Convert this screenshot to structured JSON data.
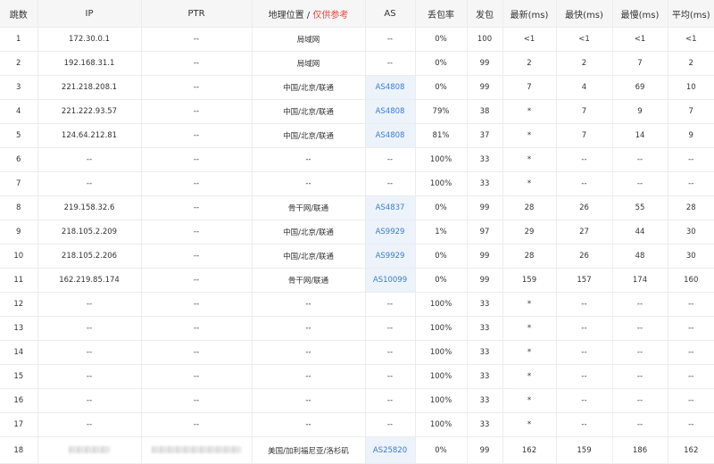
{
  "headers": {
    "hop": "跳数",
    "ip": "IP",
    "ptr": "PTR",
    "geo": "地理位置",
    "geo_sep": " / ",
    "geo_note": "仅供参考",
    "as": "AS",
    "loss": "丢包率",
    "sent": "发包",
    "last": "最新(ms)",
    "best": "最快(ms)",
    "worst": "最慢(ms)",
    "avg": "平均(ms)"
  },
  "colors": {
    "accent_link": "#3a7bd5",
    "note_red": "#e8463c",
    "as_cell_bg": "#edf3fb",
    "header_bg": "#f6f6f6"
  },
  "rows": [
    {
      "hop": "1",
      "ip": "172.30.0.1",
      "ptr": "--",
      "geo": "局域网",
      "as": "--",
      "loss": "0%",
      "sent": "100",
      "last": "<1",
      "best": "<1",
      "worst": "<1",
      "avg": "<1"
    },
    {
      "hop": "2",
      "ip": "192.168.31.1",
      "ptr": "--",
      "geo": "局域网",
      "as": "--",
      "loss": "0%",
      "sent": "99",
      "last": "2",
      "best": "2",
      "worst": "7",
      "avg": "2"
    },
    {
      "hop": "3",
      "ip": "221.218.208.1",
      "ptr": "--",
      "geo": "中国/北京/联通",
      "as": "AS4808",
      "loss": "0%",
      "sent": "99",
      "last": "7",
      "best": "4",
      "worst": "69",
      "avg": "10"
    },
    {
      "hop": "4",
      "ip": "221.222.93.57",
      "ptr": "--",
      "geo": "中国/北京/联通",
      "as": "AS4808",
      "loss": "79%",
      "sent": "38",
      "last": "*",
      "best": "7",
      "worst": "9",
      "avg": "7"
    },
    {
      "hop": "5",
      "ip": "124.64.212.81",
      "ptr": "--",
      "geo": "中国/北京/联通",
      "as": "AS4808",
      "loss": "81%",
      "sent": "37",
      "last": "*",
      "best": "7",
      "worst": "14",
      "avg": "9"
    },
    {
      "hop": "6",
      "ip": "--",
      "ptr": "--",
      "geo": "--",
      "as": "--",
      "loss": "100%",
      "sent": "33",
      "last": "*",
      "best": "--",
      "worst": "--",
      "avg": "--"
    },
    {
      "hop": "7",
      "ip": "--",
      "ptr": "--",
      "geo": "--",
      "as": "--",
      "loss": "100%",
      "sent": "33",
      "last": "*",
      "best": "--",
      "worst": "--",
      "avg": "--"
    },
    {
      "hop": "8",
      "ip": "219.158.32.6",
      "ptr": "--",
      "geo": "骨干网/联通",
      "as": "AS4837",
      "loss": "0%",
      "sent": "99",
      "last": "28",
      "best": "26",
      "worst": "55",
      "avg": "28"
    },
    {
      "hop": "9",
      "ip": "218.105.2.209",
      "ptr": "--",
      "geo": "中国/北京/联通",
      "as": "AS9929",
      "loss": "1%",
      "sent": "97",
      "last": "29",
      "best": "27",
      "worst": "44",
      "avg": "30"
    },
    {
      "hop": "10",
      "ip": "218.105.2.206",
      "ptr": "--",
      "geo": "中国/北京/联通",
      "as": "AS9929",
      "loss": "0%",
      "sent": "99",
      "last": "28",
      "best": "26",
      "worst": "48",
      "avg": "30"
    },
    {
      "hop": "11",
      "ip": "162.219.85.174",
      "ptr": "--",
      "geo": "骨干网/联通",
      "as": "AS10099",
      "loss": "0%",
      "sent": "99",
      "last": "159",
      "best": "157",
      "worst": "174",
      "avg": "160"
    },
    {
      "hop": "12",
      "ip": "--",
      "ptr": "--",
      "geo": "--",
      "as": "--",
      "loss": "100%",
      "sent": "33",
      "last": "*",
      "best": "--",
      "worst": "--",
      "avg": "--"
    },
    {
      "hop": "13",
      "ip": "--",
      "ptr": "--",
      "geo": "--",
      "as": "--",
      "loss": "100%",
      "sent": "33",
      "last": "*",
      "best": "--",
      "worst": "--",
      "avg": "--"
    },
    {
      "hop": "14",
      "ip": "--",
      "ptr": "--",
      "geo": "--",
      "as": "--",
      "loss": "100%",
      "sent": "33",
      "last": "*",
      "best": "--",
      "worst": "--",
      "avg": "--"
    },
    {
      "hop": "15",
      "ip": "--",
      "ptr": "--",
      "geo": "--",
      "as": "--",
      "loss": "100%",
      "sent": "33",
      "last": "*",
      "best": "--",
      "worst": "--",
      "avg": "--"
    },
    {
      "hop": "16",
      "ip": "--",
      "ptr": "--",
      "geo": "--",
      "as": "--",
      "loss": "100%",
      "sent": "33",
      "last": "*",
      "best": "--",
      "worst": "--",
      "avg": "--"
    },
    {
      "hop": "17",
      "ip": "--",
      "ptr": "--",
      "geo": "--",
      "as": "--",
      "loss": "100%",
      "sent": "33",
      "last": "*",
      "best": "--",
      "worst": "--",
      "avg": "--"
    },
    {
      "hop": "18",
      "ip": "",
      "ptr": "",
      "geo": "美国/加利福尼亚/洛杉矶",
      "as": "AS25820",
      "loss": "0%",
      "sent": "99",
      "last": "162",
      "best": "159",
      "worst": "186",
      "avg": "162",
      "ip_redacted": true,
      "ptr_redacted": true
    }
  ]
}
